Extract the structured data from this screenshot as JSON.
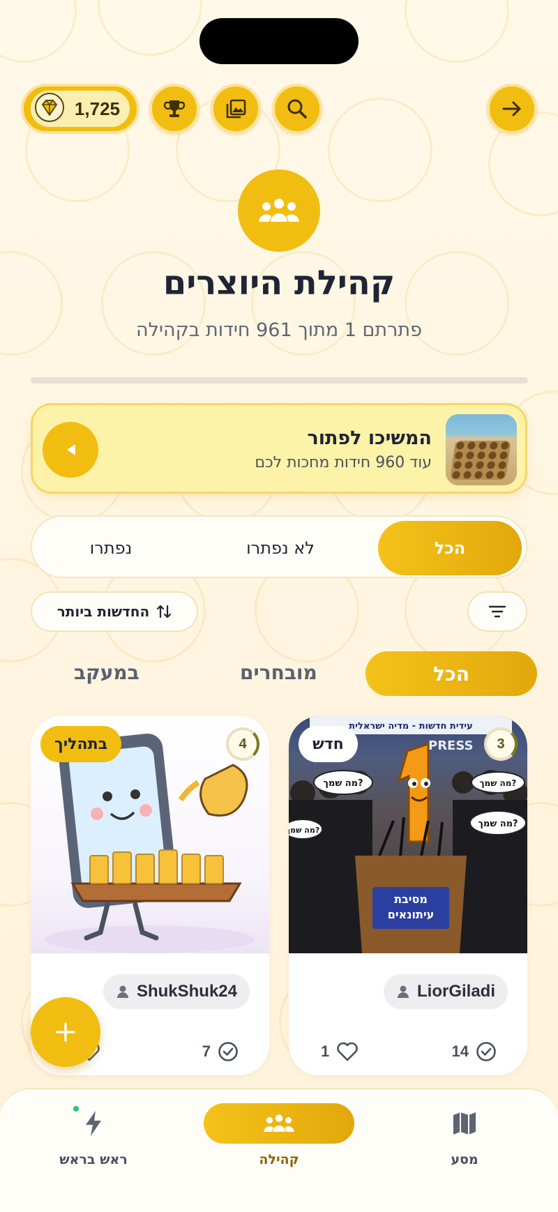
{
  "header": {
    "gems_value": "1,725",
    "icons": [
      "gem-icon",
      "trophy-icon",
      "gallery-icon",
      "search-icon",
      "arrow-right-icon"
    ]
  },
  "community": {
    "title": "קהילת היוצרים",
    "subtitle": "פתרתם 1 מתוך 961 חידות בקהילה",
    "progress_solved": 1,
    "progress_total": 961
  },
  "continue_card": {
    "title": "המשיכו לפתור",
    "subtitle": "עוד 960 חידות מחכות לכם"
  },
  "segment": {
    "options": [
      "הכל",
      "לא נפתרו",
      "נפתרו"
    ],
    "selected": "הכל"
  },
  "sort": {
    "label": "החדשות ביותר"
  },
  "tabs": {
    "all": "הכל",
    "featured": "מובחרים",
    "following": "במעקב"
  },
  "cards": [
    {
      "badge": "חדש",
      "count": "3",
      "username": "LiorGiladi",
      "solves": "14",
      "likes": "1",
      "image_texts": [
        "עידית חדשות - מדיה ישראלית",
        "PRESS",
        "מה שמך?",
        "מסיבת",
        "עיתונאים"
      ]
    },
    {
      "badge": "בתהליך",
      "count": "4",
      "username": "ShukShuk24",
      "solves": "7",
      "likes": "1"
    }
  ],
  "fab": {
    "label": "+"
  },
  "bottom_nav": {
    "items": [
      {
        "label": "מסע",
        "icon": "map-icon"
      },
      {
        "label": "קהילה",
        "icon": "community-icon",
        "active": true
      },
      {
        "label": "ראש בראש",
        "icon": "lightning-icon"
      }
    ]
  },
  "colors": {
    "accent": "#f1bd10",
    "background": "#fff7e4",
    "text": "#1f2432"
  }
}
